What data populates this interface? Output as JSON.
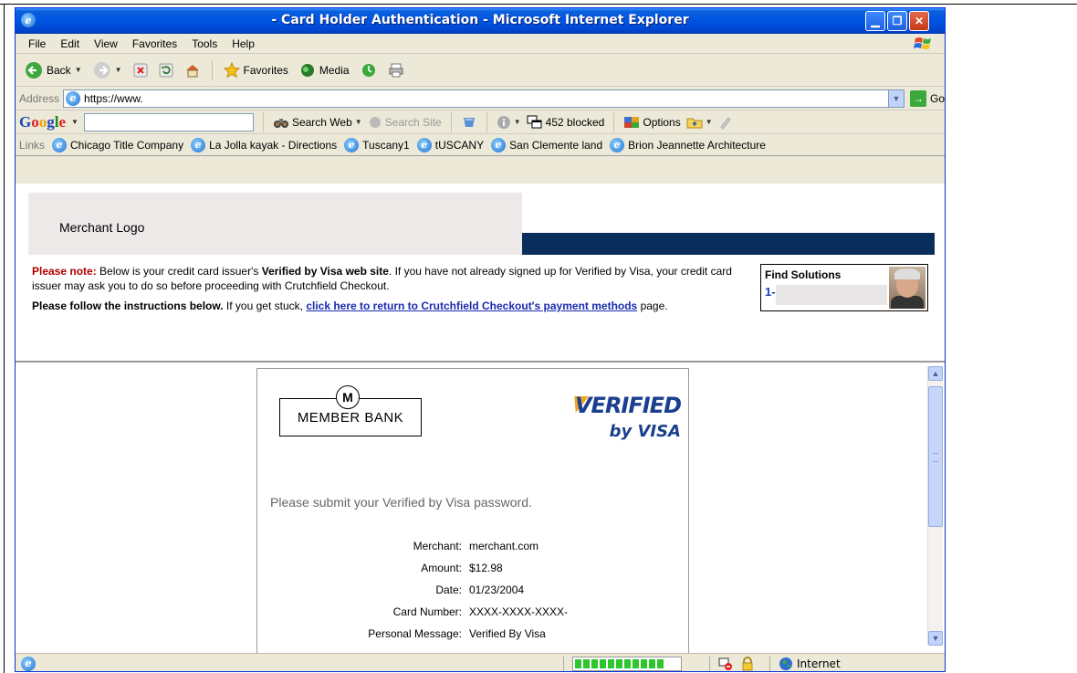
{
  "window": {
    "title": "- Card Holder Authentication - Microsoft Internet Explorer"
  },
  "menu": [
    "File",
    "Edit",
    "View",
    "Favorites",
    "Tools",
    "Help"
  ],
  "toolbar": {
    "back_label": "Back",
    "favorites_label": "Favorites",
    "media_label": "Media"
  },
  "address": {
    "label": "Address",
    "url": "https://www.",
    "go_label": "Go"
  },
  "google": {
    "logo_g": "G",
    "logo_o1": "o",
    "logo_o2": "o",
    "logo_g2": "g",
    "logo_l": "l",
    "logo_e": "e",
    "search_web": "Search Web",
    "search_site": "Search Site",
    "blocked": "452 blocked",
    "options": "Options"
  },
  "links": {
    "label": "Links",
    "items": [
      "Chicago Title Company",
      "La Jolla kayak - Directions",
      "Tuscany1",
      "tUSCANY",
      "San Clemente land",
      "Brion Jeannette Architecture"
    ]
  },
  "page": {
    "merchant_logo": "Merchant Logo",
    "notice_red": "Please note:",
    "notice_1": " Below is your credit card issuer's ",
    "notice_bold": "Verified by Visa web site",
    "notice_2": ". If you have not already signed up for Verified by Visa, your credit card issuer may ask you to do so before proceeding with Crutchfield Checkout.",
    "instructions_bold": "Please follow the instructions below.",
    "instructions_1": " If you get stuck, ",
    "instructions_link": "click here to return to Crutchfield Checkout's payment methods",
    "instructions_2": " page.",
    "find_solutions_title": "Find Solutions",
    "find_solutions_phone_prefix": "1-"
  },
  "acs": {
    "bank_name": "MEMBER BANK",
    "bank_mark": "M",
    "vbv_line1": "VERIFIED",
    "vbv_line2": "by VISA",
    "prompt": "Please submit your Verified by Visa password.",
    "details": [
      {
        "label": "Merchant:",
        "value": "merchant.com"
      },
      {
        "label": "Amount:",
        "value": "$12.98"
      },
      {
        "label": "Date:",
        "value": "01/23/2004"
      },
      {
        "label": "Card Number:",
        "value": "XXXX-XXXX-XXXX-"
      },
      {
        "label": "Personal Message:",
        "value": "Verified By Visa"
      }
    ]
  },
  "status": {
    "zone": "Internet",
    "progress": 0.85
  },
  "colors": {
    "title_blue": "#0054e3",
    "navy_bar": "#0a2e5c",
    "notice_red": "#b00000",
    "link_blue": "#1a2bb0",
    "vbv_blue": "#1b3f8f",
    "vbv_gold": "#f0a623"
  }
}
